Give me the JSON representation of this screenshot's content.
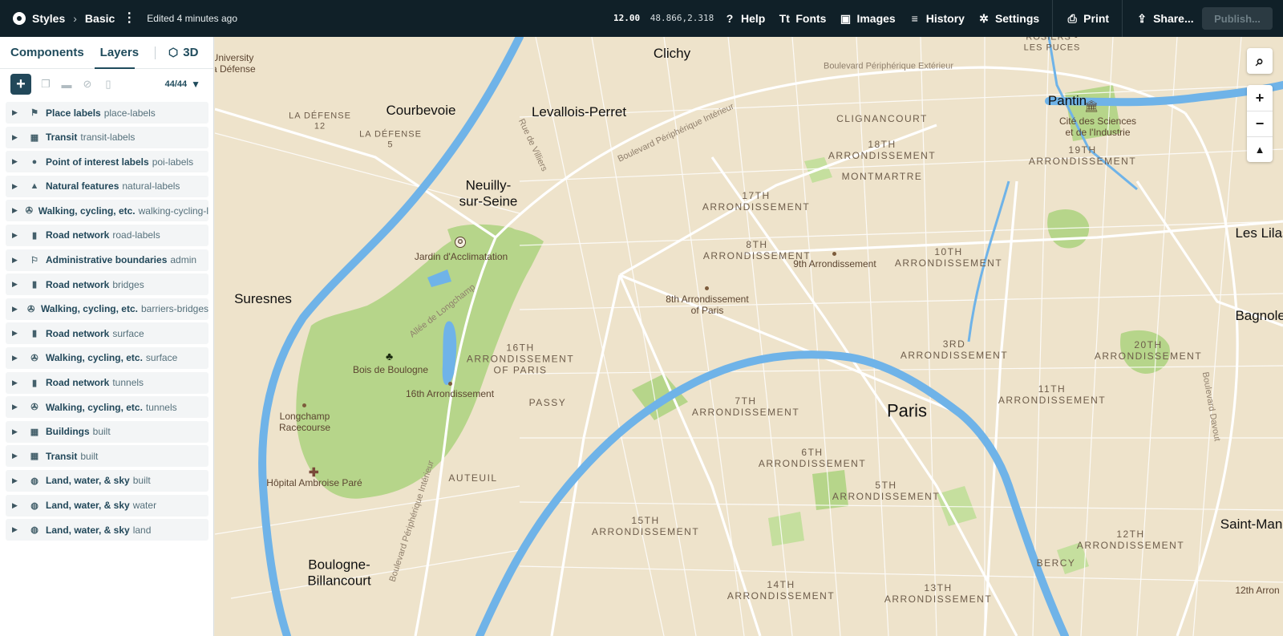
{
  "topbar": {
    "crumbs": [
      "Styles",
      "Basic"
    ],
    "edited": "Edited 4 minutes ago",
    "zoom": "12.00",
    "latlng": "48.866,2.318",
    "buttons": [
      {
        "label": "Help",
        "icon": "help-icon",
        "glyph": "?"
      },
      {
        "label": "Fonts",
        "icon": "fonts-icon",
        "glyph": "Tt"
      },
      {
        "label": "Images",
        "icon": "images-icon",
        "glyph": "▣"
      },
      {
        "label": "History",
        "icon": "history-icon",
        "glyph": "≡"
      },
      {
        "label": "Settings",
        "icon": "settings-icon",
        "glyph": "✲"
      },
      {
        "label": "Print",
        "icon": "print-icon",
        "glyph": "⎙"
      },
      {
        "label": "Share...",
        "icon": "share-icon",
        "glyph": "⇪"
      }
    ],
    "publish": "Publish..."
  },
  "sidebar": {
    "tabs": [
      "Components",
      "Layers"
    ],
    "tab_3d": "3D",
    "count": "44/44",
    "layers": [
      {
        "name": "Place labels",
        "id": "place-labels",
        "icon": "place-labels-icon",
        "glyph": "⚑"
      },
      {
        "name": "Transit",
        "id": "transit-labels",
        "icon": "transit-icon",
        "glyph": "▦"
      },
      {
        "name": "Point of interest labels",
        "id": "poi-labels",
        "icon": "pin-icon",
        "glyph": "●"
      },
      {
        "name": "Natural features",
        "id": "natural-labels",
        "icon": "mountain-icon",
        "glyph": "▲"
      },
      {
        "name": "Walking, cycling, etc.",
        "id": "walking-cycling-l",
        "icon": "walking-icon",
        "glyph": "✇"
      },
      {
        "name": "Road network",
        "id": "road-labels",
        "icon": "road-icon",
        "glyph": "▮"
      },
      {
        "name": "Administrative boundaries",
        "id": "admin",
        "icon": "flag-icon",
        "glyph": "⚐"
      },
      {
        "name": "Road network",
        "id": "bridges",
        "icon": "road-icon",
        "glyph": "▮"
      },
      {
        "name": "Walking, cycling, etc.",
        "id": "barriers-bridges",
        "icon": "walking-icon",
        "glyph": "✇"
      },
      {
        "name": "Road network",
        "id": "surface",
        "icon": "road-icon",
        "glyph": "▮"
      },
      {
        "name": "Walking, cycling, etc.",
        "id": "surface",
        "icon": "walking-icon",
        "glyph": "✇"
      },
      {
        "name": "Road network",
        "id": "tunnels",
        "icon": "road-icon",
        "glyph": "▮"
      },
      {
        "name": "Walking, cycling, etc.",
        "id": "tunnels",
        "icon": "walking-icon",
        "glyph": "✇"
      },
      {
        "name": "Buildings",
        "id": "built",
        "icon": "building-icon",
        "glyph": "▦"
      },
      {
        "name": "Transit",
        "id": "built",
        "icon": "transit-icon",
        "glyph": "▦"
      },
      {
        "name": "Land, water, & sky",
        "id": "built",
        "icon": "globe-icon",
        "glyph": "◍"
      },
      {
        "name": "Land, water, & sky",
        "id": "water",
        "icon": "globe-icon",
        "glyph": "◍"
      },
      {
        "name": "Land, water, & sky",
        "id": "land",
        "icon": "globe-icon",
        "glyph": "◍"
      }
    ]
  },
  "map": {
    "colors": {
      "land": "#eee3cb",
      "water": "#6fb3e8",
      "park": "#b9d88b",
      "road": "#ffffff"
    },
    "labels": [
      {
        "text": "Clichy",
        "kind": "city"
      },
      {
        "text": "Courbevoie",
        "kind": "city"
      },
      {
        "text": "Levallois-Perret",
        "kind": "city"
      },
      {
        "text": "Neuilly-\nsur-Seine",
        "kind": "city"
      },
      {
        "text": "Suresnes",
        "kind": "city"
      },
      {
        "text": "Paris",
        "kind": "city-big"
      },
      {
        "text": "Pantin",
        "kind": "city"
      },
      {
        "text": "Les Lilas",
        "kind": "city"
      },
      {
        "text": "Bagnolet",
        "kind": "city"
      },
      {
        "text": "Saint-Mandé",
        "kind": "city"
      },
      {
        "text": "Boulogne-\nBillancourt",
        "kind": "city"
      },
      {
        "text": "University\nla Défense",
        "kind": "poi"
      },
      {
        "text": "ROSIERS -\nLES PUCES",
        "kind": "small"
      },
      {
        "text": "LA DÉFENSE\n12",
        "kind": "small"
      },
      {
        "text": "LA DÉFENSE\n5",
        "kind": "small"
      },
      {
        "text": "CLIGNANCOURT",
        "kind": "arr"
      },
      {
        "text": "18TH\nARRONDISSEMENT",
        "kind": "arr"
      },
      {
        "text": "MONTMARTRE",
        "kind": "arr"
      },
      {
        "text": "17TH\nARRONDISSEMENT",
        "kind": "arr"
      },
      {
        "text": "19TH\nARRONDISSEMENT",
        "kind": "arr"
      },
      {
        "text": "8TH\nARRONDISSEMENT",
        "kind": "arr"
      },
      {
        "text": "10TH\nARRONDISSEMENT",
        "kind": "arr"
      },
      {
        "text": "16TH\nARRONDISSEMENT\nOF PARIS",
        "kind": "arr"
      },
      {
        "text": "3RD\nARRONDISSEMENT",
        "kind": "arr"
      },
      {
        "text": "20TH\nARRONDISSEMENT",
        "kind": "arr"
      },
      {
        "text": "11TH\nARRONDISSEMENT",
        "kind": "arr"
      },
      {
        "text": "7TH\nARRONDISSEMENT",
        "kind": "arr"
      },
      {
        "text": "PASSY",
        "kind": "arr"
      },
      {
        "text": "6TH\nARRONDISSEMENT",
        "kind": "arr"
      },
      {
        "text": "5TH\nARRONDISSEMENT",
        "kind": "arr"
      },
      {
        "text": "AUTEUIL",
        "kind": "arr"
      },
      {
        "text": "15TH\nARRONDISSEMENT",
        "kind": "arr"
      },
      {
        "text": "12TH\nARRONDISSEMENT",
        "kind": "arr"
      },
      {
        "text": "BERCY",
        "kind": "arr"
      },
      {
        "text": "14TH\nARRONDISSEMENT",
        "kind": "arr"
      },
      {
        "text": "13TH\nARRONDISSEMENT",
        "kind": "arr"
      },
      {
        "text": "12th Arron",
        "kind": "poi"
      },
      {
        "text": "Jardin d'Acclimatation",
        "kind": "poi"
      },
      {
        "text": "9th Arrondissement",
        "kind": "poi"
      },
      {
        "text": "8th Arrondissement\nof Paris",
        "kind": "poi"
      },
      {
        "text": "Bois de Boulogne",
        "kind": "poi"
      },
      {
        "text": "16th Arrondissement",
        "kind": "poi"
      },
      {
        "text": "Longchamp\nRacecourse",
        "kind": "poi"
      },
      {
        "text": "Hôpital Ambroise Paré",
        "kind": "poi"
      },
      {
        "text": "Cité des Sciences\net de l'Industrie",
        "kind": "poi"
      },
      {
        "text": "Boulevard Périphérique Extérieur",
        "kind": "road"
      },
      {
        "text": "Boulevard Périphérique Intérieur",
        "kind": "road"
      },
      {
        "text": "Rue de Villiers",
        "kind": "road"
      },
      {
        "text": "Allée de Longchamp",
        "kind": "road"
      },
      {
        "text": "Boulevard Périphérique Intérieur",
        "kind": "road"
      },
      {
        "text": "Boulevard Davout",
        "kind": "road"
      }
    ],
    "controls": {
      "search": "search-icon",
      "zoom_in": "+",
      "zoom_out": "−",
      "compass": "▲"
    }
  }
}
